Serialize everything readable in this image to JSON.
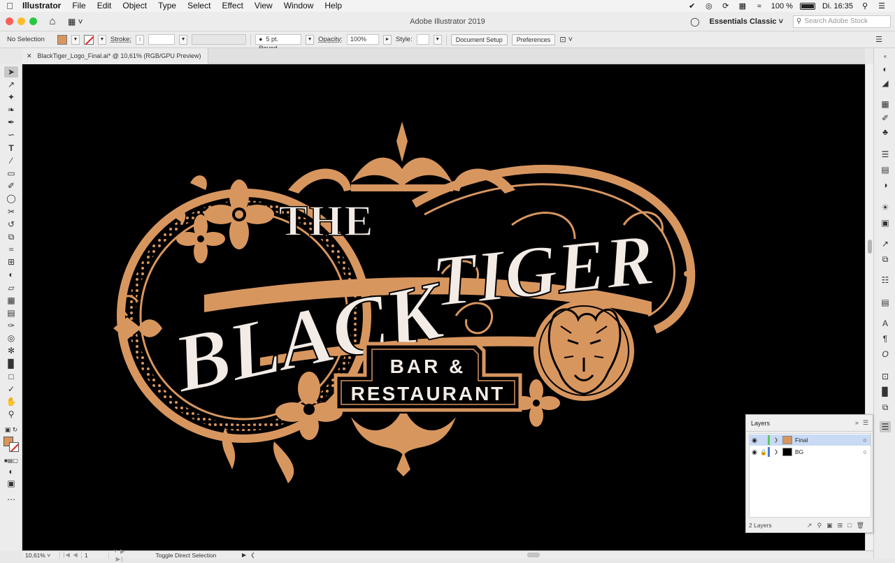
{
  "menubar": {
    "app_name": "Illustrator",
    "items": [
      "File",
      "Edit",
      "Object",
      "Type",
      "Select",
      "Effect",
      "View",
      "Window",
      "Help"
    ],
    "battery": "100 %",
    "clock": "Di. 16:35"
  },
  "titlebar": {
    "window_title": "Adobe Illustrator 2019",
    "workspace": "Essentials Classic",
    "stock_placeholder": "Search Adobe Stock"
  },
  "controlbar": {
    "selection": "No Selection",
    "stroke_label": "Stroke:",
    "brush": "5 pt. Round",
    "opacity_label": "Opacity:",
    "opacity_value": "100%",
    "style_label": "Style:",
    "document_setup": "Document Setup",
    "preferences": "Preferences",
    "fill_color": "#d8965f"
  },
  "document": {
    "tab_title": "BlackTiger_Logo_Final.ai* @ 10,61% (RGB/GPU Preview)"
  },
  "artwork": {
    "word_the": "THE",
    "word_black": "BLACK",
    "word_tiger": "TIGER",
    "line_bar": "BAR &",
    "line_restaurant": "RESTAURANT",
    "colors": {
      "gold": "#d8965f",
      "cream": "#f3ece6",
      "bg": "#000000"
    }
  },
  "status": {
    "zoom": "10,61%",
    "artboard": "1",
    "tool_status": "Toggle Direct Selection"
  },
  "layers_panel": {
    "title": "Layers",
    "layers": [
      {
        "name": "Final",
        "color": "#5ec85e",
        "selected": true,
        "locked": false
      },
      {
        "name": "BG",
        "color": "#4a78e0",
        "selected": false,
        "locked": true
      }
    ],
    "count": "2 Layers"
  }
}
